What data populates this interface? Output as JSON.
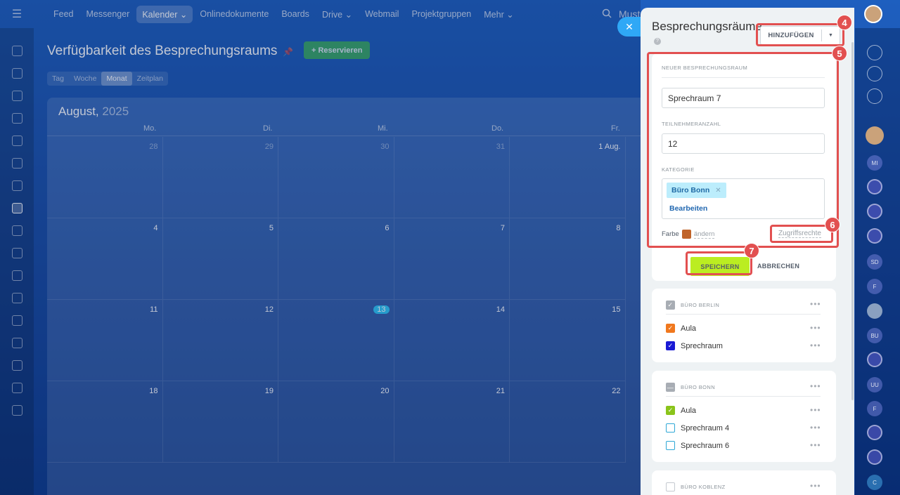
{
  "topbar": {
    "nav": [
      "Feed",
      "Messenger",
      "Kalender",
      "Onlinedokumente",
      "Boards",
      "Drive",
      "Webmail",
      "Projektgruppen",
      "Mehr"
    ],
    "active_nav": "Kalender",
    "search_text": "Must"
  },
  "main": {
    "title": "Verfügbarkeit des Besprechungsraums",
    "reserve_label": "+ Reservieren",
    "view_tabs": [
      "Tag",
      "Woche",
      "Monat",
      "Zeitplan"
    ],
    "month": "August,",
    "year": "2025",
    "weekdays": [
      "Mo.",
      "Di.",
      "Mi.",
      "Do.",
      "Fr."
    ],
    "days": [
      [
        "28",
        "29",
        "30",
        "31",
        "1 Aug."
      ],
      [
        "4",
        "5",
        "6",
        "7",
        "8"
      ],
      [
        "11",
        "12",
        "13",
        "14",
        "15"
      ],
      [
        "18",
        "19",
        "20",
        "21",
        "22"
      ]
    ],
    "today": "13"
  },
  "panel": {
    "title": "Besprechungsräume",
    "add_label": "HINZUFÜGEN",
    "form": {
      "section_new": "NEUER BESPRECHUNGSRAUM",
      "name_value": "Sprechraum 7",
      "capacity_label": "TEILNEHMERANZAHL",
      "capacity_value": "12",
      "category_label": "KATEGORIE",
      "category_tag": "Büro Bonn",
      "edit_label": "Bearbeiten",
      "color_label": "Farbe",
      "color_value": "#c0642a",
      "change_label": "ändern",
      "rights_label": "Zugriffsrechte",
      "save_label": "SPEICHERN",
      "cancel_label": "ABBRECHEN"
    },
    "groups": [
      {
        "name": "BÜRO BERLIN",
        "items": [
          {
            "label": "Aula",
            "color": "#f0781e"
          },
          {
            "label": "Sprechraum",
            "color": "#1a1ad4"
          }
        ]
      },
      {
        "name": "BÜRO BONN",
        "items": [
          {
            "label": "Aula",
            "color": "#8ac41a"
          },
          {
            "label": "Sprechraum 4",
            "color": "#2fa8d6"
          },
          {
            "label": "Sprechraum 6",
            "color": "#2fa8d6"
          }
        ]
      },
      {
        "name": "BÜRO KOBLENZ",
        "items": []
      }
    ]
  },
  "badges": [
    "4",
    "5",
    "6",
    "7"
  ],
  "right_rail": [
    "MI",
    "SD",
    "F",
    "BU",
    "UU",
    "F",
    "C"
  ]
}
